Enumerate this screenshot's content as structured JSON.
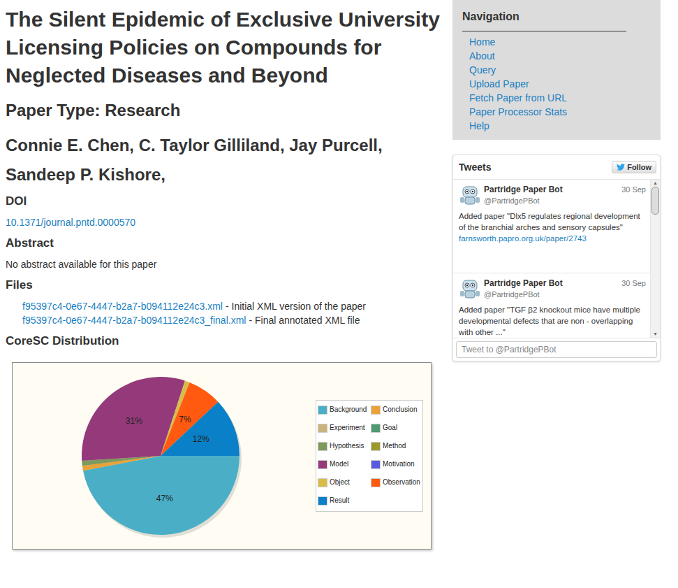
{
  "page": {
    "title": "The Silent Epidemic of Exclusive University Licensing Policies on Compounds for Neglected Diseases and Beyond",
    "paper_type": "Paper Type: Research",
    "authors": "Connie E. Chen, C. Taylor Gilliland, Jay Purcell, Sandeep P. Kishore,",
    "doi": {
      "heading": "DOI",
      "link": "10.1371/journal.pntd.0000570"
    },
    "abstract": {
      "heading": "Abstract",
      "text": "No abstract available for this paper"
    },
    "files": {
      "heading": "Files",
      "items": [
        {
          "name": "f95397c4-0e67-4447-b2a7-b094112e24c3.xml",
          "description": "- Initial XML version of the paper"
        },
        {
          "name": "f95397c4-0e67-4447-b2a7-b094112e24c3_final.xml",
          "description": "- Final annotated XML file"
        }
      ]
    },
    "chart": {
      "title": "CoreSC Distribution",
      "slices": [
        {
          "category": "Background",
          "value": 47,
          "label": "47%",
          "color": "#4aafc6"
        },
        {
          "category": "Conclusion",
          "value": 1,
          "label": "",
          "color": "#e9a23a"
        },
        {
          "category": "Experiment",
          "value": 0,
          "label": "",
          "color": "#c8b47e"
        },
        {
          "category": "Goal",
          "value": 0,
          "label": "",
          "color": "#4f9a6e"
        },
        {
          "category": "Hypothesis",
          "value": 1,
          "label": "",
          "color": "#7d9a5c"
        },
        {
          "category": "Method",
          "value": 0,
          "label": "",
          "color": "#9a9a2a"
        },
        {
          "category": "Model",
          "value": 31,
          "label": "31%",
          "color": "#943a7a"
        },
        {
          "category": "Motivation",
          "value": 0,
          "label": "",
          "color": "#5a5ae0"
        },
        {
          "category": "Object",
          "value": 1,
          "label": "",
          "color": "#d9bd4a"
        },
        {
          "category": "Observation",
          "value": 7,
          "label": "7%",
          "color": "#ff5a10"
        },
        {
          "category": "Result",
          "value": 12,
          "label": "12%",
          "color": "#0a80c8"
        }
      ]
    }
  },
  "navigation": {
    "title": "Navigation",
    "items": [
      "Home",
      "About",
      "Query",
      "Upload Paper",
      "Fetch Paper from URL",
      "Paper Processor Stats",
      "Help"
    ]
  },
  "tweets": {
    "title": "Tweets",
    "follow": "Follow",
    "scroll_level": 0,
    "items": [
      {
        "name": "Partridge Paper Bot",
        "handle": "@PartridgePBot",
        "date": "30 Sep",
        "text": "Added paper \"Dlx5 regulates regional development of the branchial arches and sensory capsules\"",
        "link": "farnsworth.papro.org.uk/paper/2743"
      },
      {
        "name": "Partridge Paper Bot",
        "handle": "@PartridgePBot",
        "date": "30 Sep",
        "text": "Added paper \"TGF β2 knockout mice have multiple developmental defects that are non - overlapping with other ...\"",
        "link": ""
      }
    ],
    "input_placeholder": "Tweet to @PartridgePBot"
  }
}
